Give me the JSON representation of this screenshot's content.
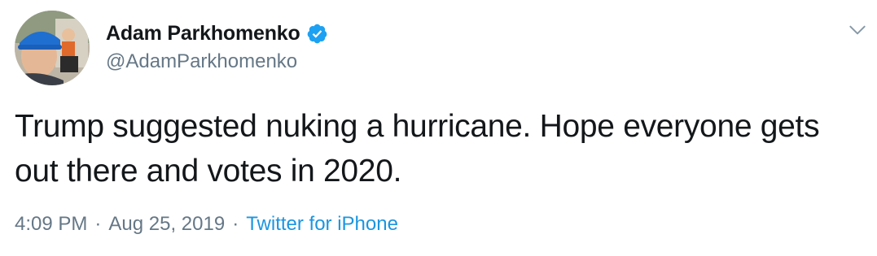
{
  "tweet": {
    "author": {
      "display_name": "Adam Parkhomenko",
      "handle": "@AdamParkhomenko",
      "verified": true,
      "avatar_icon": "profile-photo"
    },
    "text": "Trump suggested nuking a hurricane. Hope everyone gets out there and votes in 2020.",
    "meta": {
      "time": "4:09 PM",
      "separator": "·",
      "date": "Aug 25, 2019",
      "source": "Twitter for iPhone"
    },
    "menu_icon": "chevron-down-icon"
  },
  "colors": {
    "text": "#14171a",
    "secondary": "#657786",
    "link": "#1b95e0",
    "verified": "#1da1f2"
  }
}
